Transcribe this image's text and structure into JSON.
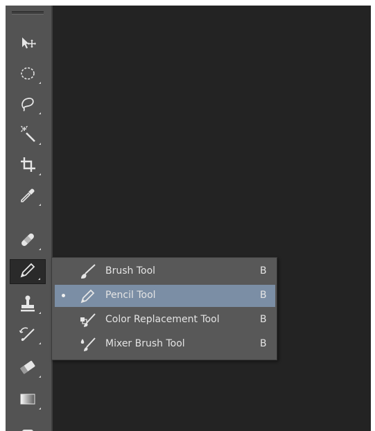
{
  "toolbar": {
    "tools": [
      {
        "name": "move-tool",
        "icon": "move-icon"
      },
      {
        "name": "elliptical-marquee-tool",
        "icon": "ellipse-marquee-icon"
      },
      {
        "name": "lasso-tool",
        "icon": "lasso-icon"
      },
      {
        "name": "magic-wand-tool",
        "icon": "magic-wand-icon"
      },
      {
        "name": "crop-tool",
        "icon": "crop-icon"
      },
      {
        "name": "eyedropper-tool",
        "icon": "eyedropper-icon"
      },
      {
        "name": "healing-brush-tool",
        "icon": "bandage-icon"
      },
      {
        "name": "pencil-tool",
        "icon": "pencil-icon",
        "active": true
      },
      {
        "name": "clone-stamp-tool",
        "icon": "stamp-icon"
      },
      {
        "name": "history-brush-tool",
        "icon": "history-brush-icon"
      },
      {
        "name": "eraser-tool",
        "icon": "eraser-icon"
      },
      {
        "name": "gradient-tool",
        "icon": "gradient-icon"
      }
    ]
  },
  "flyout": {
    "items": [
      {
        "label": "Brush Tool",
        "shortcut": "B",
        "icon": "brush-icon"
      },
      {
        "label": "Pencil Tool",
        "shortcut": "B",
        "icon": "pencil-icon",
        "selected": true
      },
      {
        "label": "Color Replacement Tool",
        "shortcut": "B",
        "icon": "color-replacement-icon"
      },
      {
        "label": "Mixer Brush Tool",
        "shortcut": "B",
        "icon": "mixer-brush-icon"
      }
    ]
  },
  "colors": {
    "canvas": "#232323",
    "toolbar": "#535353",
    "flyout": "#585858",
    "selection": "#7b8ea5",
    "text": "#e4e4e4"
  }
}
